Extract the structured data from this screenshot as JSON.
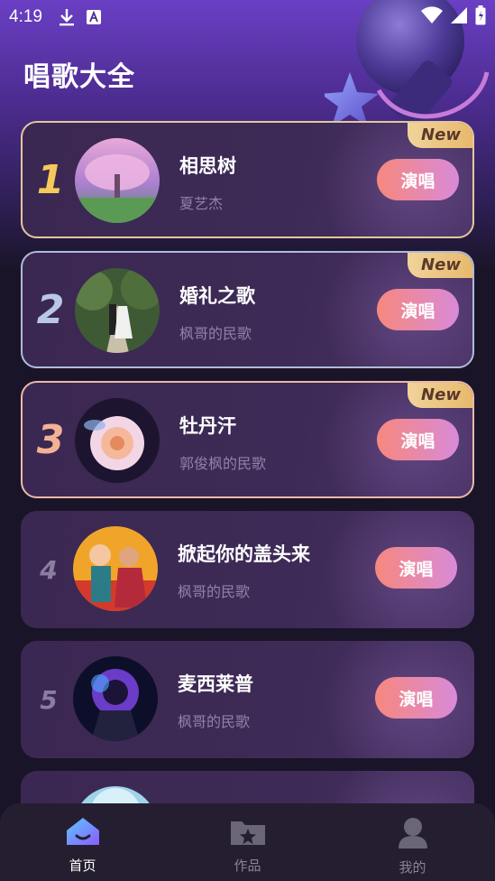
{
  "status_bar": {
    "time": "4:19"
  },
  "app": {
    "title": "唱歌大全"
  },
  "songs": [
    {
      "rank": "1",
      "title": "相思树",
      "artist": "夏艺杰",
      "button": "演唱",
      "badge": "New"
    },
    {
      "rank": "2",
      "title": "婚礼之歌",
      "artist": "枫哥的民歌",
      "button": "演唱",
      "badge": "New"
    },
    {
      "rank": "3",
      "title": "牡丹汗",
      "artist": "郭俊枫的民歌",
      "button": "演唱",
      "badge": "New"
    },
    {
      "rank": "4",
      "title": "掀起你的盖头来",
      "artist": "枫哥的民歌",
      "button": "演唱"
    },
    {
      "rank": "5",
      "title": "麦西莱普",
      "artist": "枫哥的民歌",
      "button": "演唱"
    }
  ],
  "bottom_nav": {
    "items": [
      {
        "label": "首页",
        "icon": "home-icon",
        "active": true
      },
      {
        "label": "作品",
        "icon": "folder-star-icon",
        "active": false
      },
      {
        "label": "我的",
        "icon": "person-icon",
        "active": false
      }
    ]
  },
  "colors": {
    "background": "#1a1428",
    "header_gradient_top": "#6a3fc4",
    "gold": "#f5c95a",
    "silver": "#b8c7e4",
    "bronze": "#f4b294",
    "sing_button_start": "#f6887c",
    "sing_button_end": "#d98ad9",
    "nav_bg": "#241e30"
  }
}
